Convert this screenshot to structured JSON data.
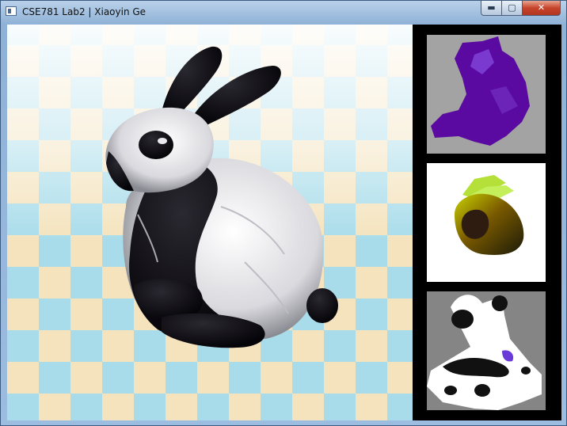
{
  "window": {
    "title": "CSE781 Lab2 | Xiaoyin Ge",
    "buttons": {
      "minimize": "▬",
      "maximize": "▢",
      "close": "✕"
    }
  },
  "scene": {
    "background_colors": {
      "checker_a": "#f4e3bd",
      "checker_b": "#a8dcea"
    },
    "model": "bunny",
    "bunny_colors": {
      "white": "#ffffff",
      "black": "#0b0a12"
    }
  },
  "thumbnails": [
    {
      "name": "point-cloud-view",
      "background": "#a3a3a3",
      "model_color": "#5a0aa0"
    },
    {
      "name": "normal-color-view",
      "background": "#ffffff",
      "model_color": "#6b5210"
    },
    {
      "name": "texture-map-view",
      "background": "#858585",
      "model_color": "#ffffff"
    }
  ]
}
